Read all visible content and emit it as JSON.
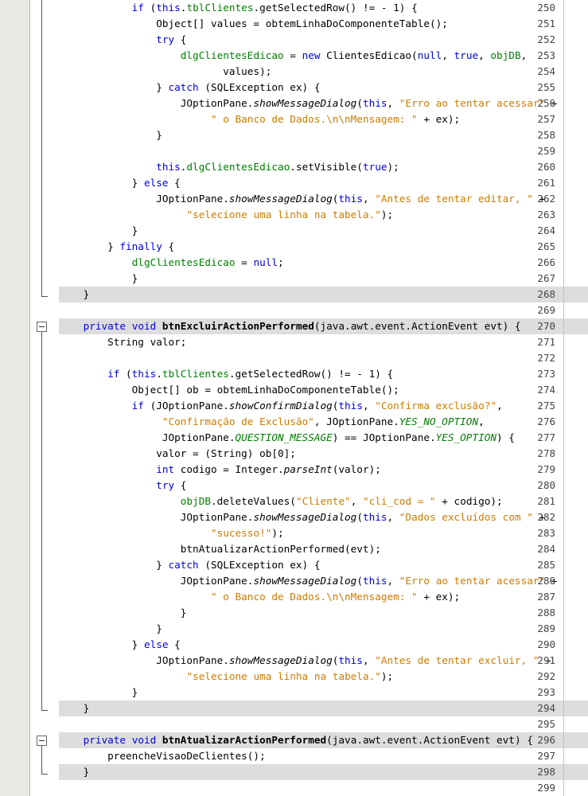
{
  "editor": {
    "type": "java-source-editor",
    "language": "Java",
    "first_line": 250,
    "last_line": 299,
    "line_height": 20,
    "colors": {
      "background": "#ffffff",
      "gutter_background": "#e9e8e2",
      "line_number": "#444444",
      "method_band": "#dddddd",
      "keyword": "#0000e6",
      "string": "#ce7b00",
      "field": "#008000",
      "static_constant": "#008000",
      "right_margin": "#f5a9a9",
      "fold_guide": "#555555"
    }
  },
  "lines": [
    {
      "n": 250,
      "band": false,
      "indent": 12,
      "tokens": [
        {
          "t": "if ",
          "c": "kw"
        },
        {
          "t": "(",
          "c": "pl"
        },
        {
          "t": "this",
          "c": "kw"
        },
        {
          "t": ".",
          "c": "pl"
        },
        {
          "t": "tblClientes",
          "c": "fld"
        },
        {
          "t": ".getSelectedRow() != - 1) {",
          "c": "pl"
        }
      ]
    },
    {
      "n": 251,
      "band": false,
      "indent": 16,
      "tokens": [
        {
          "t": "Object[] values = obtemLinhaDoComponenteTable();",
          "c": "pl"
        }
      ]
    },
    {
      "n": 252,
      "band": false,
      "indent": 16,
      "tokens": [
        {
          "t": "try",
          "c": "kw"
        },
        {
          "t": " {",
          "c": "pl"
        }
      ]
    },
    {
      "n": 253,
      "band": false,
      "indent": 20,
      "tokens": [
        {
          "t": "dlgClientesEdicao",
          "c": "fld"
        },
        {
          "t": " = ",
          "c": "pl"
        },
        {
          "t": "new",
          "c": "kw"
        },
        {
          "t": " ClientesEdicao(",
          "c": "pl"
        },
        {
          "t": "null",
          "c": "kw"
        },
        {
          "t": ", ",
          "c": "pl"
        },
        {
          "t": "true",
          "c": "kw"
        },
        {
          "t": ", ",
          "c": "pl"
        },
        {
          "t": "objDB",
          "c": "fld"
        },
        {
          "t": ",",
          "c": "pl"
        }
      ]
    },
    {
      "n": 254,
      "band": false,
      "indent": 27,
      "tokens": [
        {
          "t": "values);",
          "c": "pl"
        }
      ]
    },
    {
      "n": 255,
      "band": false,
      "indent": 16,
      "tokens": [
        {
          "t": "} ",
          "c": "pl"
        },
        {
          "t": "catch",
          "c": "kw"
        },
        {
          "t": " (SQLException ex) {",
          "c": "pl"
        }
      ]
    },
    {
      "n": 256,
      "band": false,
      "indent": 20,
      "tokens": [
        {
          "t": "JOptionPane.",
          "c": "pl"
        },
        {
          "t": "showMessageDialog",
          "c": "mi"
        },
        {
          "t": "(",
          "c": "pl"
        },
        {
          "t": "this",
          "c": "kw"
        },
        {
          "t": ", ",
          "c": "pl"
        },
        {
          "t": "\"Erro ao tentar acessar\"",
          "c": "str"
        },
        {
          "t": " +",
          "c": "pl"
        }
      ]
    },
    {
      "n": 257,
      "band": false,
      "indent": 25,
      "tokens": [
        {
          "t": "\" o Banco de Dados.\\n\\nMensagem: \"",
          "c": "str"
        },
        {
          "t": " + ex);",
          "c": "pl"
        }
      ]
    },
    {
      "n": 258,
      "band": false,
      "indent": 16,
      "tokens": [
        {
          "t": "}",
          "c": "pl"
        }
      ]
    },
    {
      "n": 259,
      "band": false,
      "indent": 0,
      "tokens": []
    },
    {
      "n": 260,
      "band": false,
      "indent": 16,
      "tokens": [
        {
          "t": "this",
          "c": "kw"
        },
        {
          "t": ".",
          "c": "pl"
        },
        {
          "t": "dlgClientesEdicao",
          "c": "fld"
        },
        {
          "t": ".setVisible(",
          "c": "pl"
        },
        {
          "t": "true",
          "c": "kw"
        },
        {
          "t": ");",
          "c": "pl"
        }
      ]
    },
    {
      "n": 261,
      "band": false,
      "indent": 12,
      "tokens": [
        {
          "t": "} ",
          "c": "pl"
        },
        {
          "t": "else",
          "c": "kw"
        },
        {
          "t": " {",
          "c": "pl"
        }
      ]
    },
    {
      "n": 262,
      "band": false,
      "indent": 16,
      "tokens": [
        {
          "t": "JOptionPane.",
          "c": "pl"
        },
        {
          "t": "showMessageDialog",
          "c": "mi"
        },
        {
          "t": "(",
          "c": "pl"
        },
        {
          "t": "this",
          "c": "kw"
        },
        {
          "t": ", ",
          "c": "pl"
        },
        {
          "t": "\"Antes de tentar editar, \"",
          "c": "str"
        },
        {
          "t": " +",
          "c": "pl"
        }
      ]
    },
    {
      "n": 263,
      "band": false,
      "indent": 21,
      "tokens": [
        {
          "t": "\"selecione uma linha na tabela.\"",
          "c": "str"
        },
        {
          "t": ");",
          "c": "pl"
        }
      ]
    },
    {
      "n": 264,
      "band": false,
      "indent": 12,
      "tokens": [
        {
          "t": "}",
          "c": "pl"
        }
      ]
    },
    {
      "n": 265,
      "band": false,
      "indent": 8,
      "tokens": [
        {
          "t": "} ",
          "c": "pl"
        },
        {
          "t": "finally",
          "c": "kw"
        },
        {
          "t": " {",
          "c": "pl"
        }
      ]
    },
    {
      "n": 266,
      "band": false,
      "indent": 12,
      "tokens": [
        {
          "t": "dlgClientesEdicao",
          "c": "fld"
        },
        {
          "t": " = ",
          "c": "pl"
        },
        {
          "t": "null",
          "c": "kw"
        },
        {
          "t": ";",
          "c": "pl"
        }
      ]
    },
    {
      "n": 267,
      "band": false,
      "indent": 12,
      "tokens": [
        {
          "t": "}",
          "c": "pl"
        }
      ]
    },
    {
      "n": 268,
      "band": true,
      "indent": 4,
      "tokens": [
        {
          "t": "}",
          "c": "pl"
        }
      ]
    },
    {
      "n": 269,
      "band": false,
      "indent": 0,
      "tokens": []
    },
    {
      "n": 270,
      "band": true,
      "indent": 4,
      "tokens": [
        {
          "t": "private",
          "c": "kw"
        },
        {
          "t": " ",
          "c": "pl"
        },
        {
          "t": "void",
          "c": "kw"
        },
        {
          "t": " ",
          "c": "pl"
        },
        {
          "t": "btnExcluirActionPerformed",
          "c": "mb"
        },
        {
          "t": "(java.awt.event.ActionEvent evt) {",
          "c": "pl"
        }
      ]
    },
    {
      "n": 271,
      "band": false,
      "indent": 8,
      "tokens": [
        {
          "t": "String valor;",
          "c": "pl"
        }
      ]
    },
    {
      "n": 272,
      "band": false,
      "indent": 0,
      "tokens": []
    },
    {
      "n": 273,
      "band": false,
      "indent": 8,
      "tokens": [
        {
          "t": "if ",
          "c": "kw"
        },
        {
          "t": "(",
          "c": "pl"
        },
        {
          "t": "this",
          "c": "kw"
        },
        {
          "t": ".",
          "c": "pl"
        },
        {
          "t": "tblClientes",
          "c": "fld"
        },
        {
          "t": ".getSelectedRow() != - 1) {",
          "c": "pl"
        }
      ]
    },
    {
      "n": 274,
      "band": false,
      "indent": 12,
      "tokens": [
        {
          "t": "Object[] ob = obtemLinhaDoComponenteTable();",
          "c": "pl"
        }
      ]
    },
    {
      "n": 275,
      "band": false,
      "indent": 12,
      "tokens": [
        {
          "t": "if ",
          "c": "kw"
        },
        {
          "t": "(JOptionPane.",
          "c": "pl"
        },
        {
          "t": "showConfirmDialog",
          "c": "mi"
        },
        {
          "t": "(",
          "c": "pl"
        },
        {
          "t": "this",
          "c": "kw"
        },
        {
          "t": ", ",
          "c": "pl"
        },
        {
          "t": "\"Confirma exclusão?\"",
          "c": "str"
        },
        {
          "t": ",",
          "c": "pl"
        }
      ]
    },
    {
      "n": 276,
      "band": false,
      "indent": 17,
      "tokens": [
        {
          "t": "\"Confirmação de Exclusão\"",
          "c": "str"
        },
        {
          "t": ", JOptionPane.",
          "c": "pl"
        },
        {
          "t": "YES_NO_OPTION",
          "c": "stat"
        },
        {
          "t": ",",
          "c": "pl"
        }
      ]
    },
    {
      "n": 277,
      "band": false,
      "indent": 17,
      "tokens": [
        {
          "t": "JOptionPane.",
          "c": "pl"
        },
        {
          "t": "QUESTION_MESSAGE",
          "c": "stat"
        },
        {
          "t": ") == JOptionPane.",
          "c": "pl"
        },
        {
          "t": "YES_OPTION",
          "c": "stat"
        },
        {
          "t": ") {",
          "c": "pl"
        }
      ]
    },
    {
      "n": 278,
      "band": false,
      "indent": 16,
      "tokens": [
        {
          "t": "valor = (String) ob[0];",
          "c": "pl"
        }
      ]
    },
    {
      "n": 279,
      "band": false,
      "indent": 16,
      "tokens": [
        {
          "t": "int",
          "c": "kw"
        },
        {
          "t": " codigo = Integer.",
          "c": "pl"
        },
        {
          "t": "parseInt",
          "c": "mi"
        },
        {
          "t": "(valor);",
          "c": "pl"
        }
      ]
    },
    {
      "n": 280,
      "band": false,
      "indent": 16,
      "tokens": [
        {
          "t": "try",
          "c": "kw"
        },
        {
          "t": " {",
          "c": "pl"
        }
      ]
    },
    {
      "n": 281,
      "band": false,
      "indent": 20,
      "tokens": [
        {
          "t": "objDB",
          "c": "fld"
        },
        {
          "t": ".deleteValues(",
          "c": "pl"
        },
        {
          "t": "\"Cliente\"",
          "c": "str"
        },
        {
          "t": ", ",
          "c": "pl"
        },
        {
          "t": "\"cli_cod = \"",
          "c": "str"
        },
        {
          "t": " + codigo);",
          "c": "pl"
        }
      ]
    },
    {
      "n": 282,
      "band": false,
      "indent": 20,
      "tokens": [
        {
          "t": "JOptionPane.",
          "c": "pl"
        },
        {
          "t": "showMessageDialog",
          "c": "mi"
        },
        {
          "t": "(",
          "c": "pl"
        },
        {
          "t": "this",
          "c": "kw"
        },
        {
          "t": ", ",
          "c": "pl"
        },
        {
          "t": "\"Dados excluídos com \"",
          "c": "str"
        },
        {
          "t": " +",
          "c": "pl"
        }
      ]
    },
    {
      "n": 283,
      "band": false,
      "indent": 25,
      "tokens": [
        {
          "t": "\"sucesso!\"",
          "c": "str"
        },
        {
          "t": ");",
          "c": "pl"
        }
      ]
    },
    {
      "n": 284,
      "band": false,
      "indent": 20,
      "tokens": [
        {
          "t": "btnAtualizarActionPerformed(evt);",
          "c": "pl"
        }
      ]
    },
    {
      "n": 285,
      "band": false,
      "indent": 16,
      "tokens": [
        {
          "t": "} ",
          "c": "pl"
        },
        {
          "t": "catch",
          "c": "kw"
        },
        {
          "t": " (SQLException ex) {",
          "c": "pl"
        }
      ]
    },
    {
      "n": 286,
      "band": false,
      "indent": 20,
      "tokens": [
        {
          "t": "JOptionPane.",
          "c": "pl"
        },
        {
          "t": "showMessageDialog",
          "c": "mi"
        },
        {
          "t": "(",
          "c": "pl"
        },
        {
          "t": "this",
          "c": "kw"
        },
        {
          "t": ", ",
          "c": "pl"
        },
        {
          "t": "\"Erro ao tentar acessar\"",
          "c": "str"
        },
        {
          "t": " +",
          "c": "pl"
        }
      ]
    },
    {
      "n": 287,
      "band": false,
      "indent": 25,
      "tokens": [
        {
          "t": "\" o Banco de Dados.\\n\\nMensagem: \"",
          "c": "str"
        },
        {
          "t": " + ex);",
          "c": "pl"
        }
      ]
    },
    {
      "n": 288,
      "band": false,
      "indent": 20,
      "tokens": [
        {
          "t": "}",
          "c": "pl"
        }
      ]
    },
    {
      "n": 289,
      "band": false,
      "indent": 16,
      "tokens": [
        {
          "t": "}",
          "c": "pl"
        }
      ]
    },
    {
      "n": 290,
      "band": false,
      "indent": 12,
      "tokens": [
        {
          "t": "} ",
          "c": "pl"
        },
        {
          "t": "else",
          "c": "kw"
        },
        {
          "t": " {",
          "c": "pl"
        }
      ]
    },
    {
      "n": 291,
      "band": false,
      "indent": 16,
      "tokens": [
        {
          "t": "JOptionPane.",
          "c": "pl"
        },
        {
          "t": "showMessageDialog",
          "c": "mi"
        },
        {
          "t": "(",
          "c": "pl"
        },
        {
          "t": "this",
          "c": "kw"
        },
        {
          "t": ", ",
          "c": "pl"
        },
        {
          "t": "\"Antes de tentar excluir, \"",
          "c": "str"
        },
        {
          "t": " +",
          "c": "pl"
        }
      ]
    },
    {
      "n": 292,
      "band": false,
      "indent": 21,
      "tokens": [
        {
          "t": "\"selecione uma linha na tabela.\"",
          "c": "str"
        },
        {
          "t": ");",
          "c": "pl"
        }
      ]
    },
    {
      "n": 293,
      "band": false,
      "indent": 12,
      "tokens": [
        {
          "t": "}",
          "c": "pl"
        }
      ]
    },
    {
      "n": 294,
      "band": true,
      "indent": 4,
      "tokens": [
        {
          "t": "}",
          "c": "pl"
        }
      ]
    },
    {
      "n": 295,
      "band": false,
      "indent": 0,
      "tokens": []
    },
    {
      "n": 296,
      "band": true,
      "indent": 4,
      "tokens": [
        {
          "t": "private",
          "c": "kw"
        },
        {
          "t": " ",
          "c": "pl"
        },
        {
          "t": "void",
          "c": "kw"
        },
        {
          "t": " ",
          "c": "pl"
        },
        {
          "t": "btnAtualizarActionPerformed",
          "c": "mb"
        },
        {
          "t": "(java.awt.event.ActionEvent ",
          "c": "pl"
        },
        {
          "t": "evt",
          "c": "warn"
        },
        {
          "t": ") {",
          "c": "pl"
        }
      ]
    },
    {
      "n": 297,
      "band": false,
      "indent": 8,
      "tokens": [
        {
          "t": "preencheVisaoDeClientes();",
          "c": "pl"
        }
      ]
    },
    {
      "n": 298,
      "band": true,
      "indent": 4,
      "tokens": [
        {
          "t": "}",
          "c": "pl"
        }
      ]
    },
    {
      "n": 299,
      "band": false,
      "indent": 0,
      "tokens": []
    }
  ],
  "fold_guides": [
    {
      "from_line": 250,
      "to_line": 268,
      "elbow": true
    },
    {
      "from_line": 270,
      "to_line": 294,
      "elbow": true
    },
    {
      "from_line": 296,
      "to_line": 298,
      "elbow": true
    }
  ],
  "fold_boxes": [
    {
      "line": 270,
      "state": "expanded",
      "glyph": "minus"
    },
    {
      "line": 296,
      "state": "expanded",
      "glyph": "minus"
    }
  ]
}
